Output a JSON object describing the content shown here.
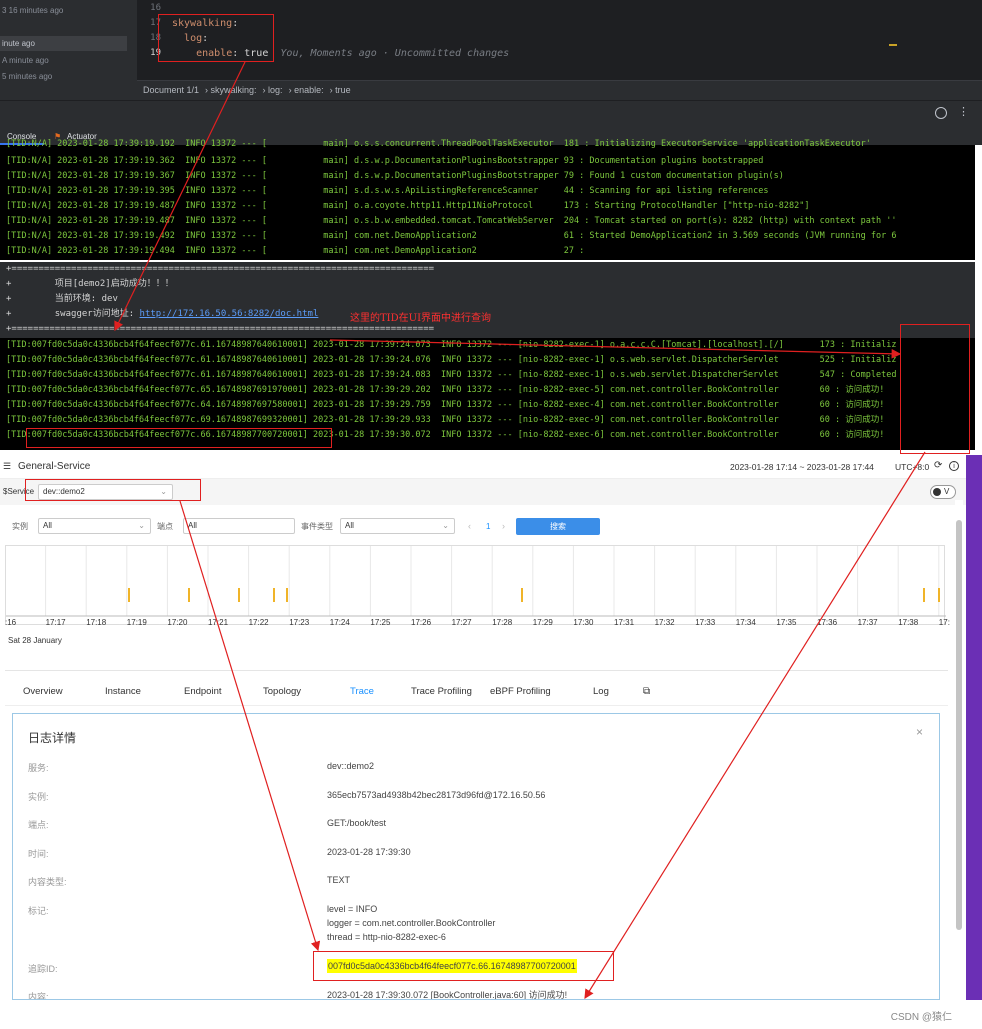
{
  "ide": {
    "sidebar_items": [
      "3 16 minutes ago",
      "inute ago",
      "A minute ago",
      "5 minutes ago"
    ],
    "gutter": [
      "16",
      "17",
      "18",
      "19"
    ],
    "code": {
      "line17_key": "skywalking",
      "line18_key": "log",
      "line19_key": "enable",
      "line19_value": "true",
      "line19_blame": "You, Moments ago · Uncommitted changes"
    },
    "breadcrumb": [
      "Document 1/1",
      "skywalking:",
      "log:",
      "enable:",
      "true"
    ],
    "tabs": {
      "console": "Console",
      "actuator": "Actuator"
    }
  },
  "console_top": [
    "[TID:N/A] 2023-01-28 17:39:19.192  INFO 13372 --- [           main] o.s.s.concurrent.ThreadPoolTaskExecutor  181 : Initializing ExecutorService 'applicationTaskExecutor'",
    "[TID:N/A] 2023-01-28 17:39:19.362  INFO 13372 --- [           main] d.s.w.p.DocumentationPluginsBootstrapper 93 : Documentation plugins bootstrapped",
    "[TID:N/A] 2023-01-28 17:39:19.367  INFO 13372 --- [           main] d.s.w.p.DocumentationPluginsBootstrapper 79 : Found 1 custom documentation plugin(s)",
    "[TID:N/A] 2023-01-28 17:39:19.395  INFO 13372 --- [           main] s.d.s.w.s.ApiListingReferenceScanner     44 : Scanning for api listing references",
    "[TID:N/A] 2023-01-28 17:39:19.487  INFO 13372 --- [           main] o.a.coyote.http11.Http11NioProtocol      173 : Starting ProtocolHandler [\"http-nio-8282\"]",
    "[TID:N/A] 2023-01-28 17:39:19.487  INFO 13372 --- [           main] o.s.b.w.embedded.tomcat.TomcatWebServer  204 : Tomcat started on port(s): 8282 (http) with context path ''",
    "[TID:N/A] 2023-01-28 17:39:19.492  INFO 13372 --- [           main] com.net.DemoApplication2                 61 : Started DemoApplication2 in 3.569 seconds (JVM running for 6",
    "[TID:N/A] 2023-01-28 17:39:19.494  INFO 13372 --- [           main] com.net.DemoApplication2                 27 :"
  ],
  "banner": {
    "rule": "+==============================================================================",
    "line1": "+        项目[demo2]启动成功！！！",
    "line2": "+        当前环境: dev",
    "line3_prefix": "+        swagger访问地址: ",
    "line3_link": "http://172.16.50.56:8282/doc.html",
    "annotation": "这里的TID在UI界面中进行查询"
  },
  "console_bottom": [
    "[TID:007fd0c5da0c4336bcb4f64feecf077c.61.16748987640610001] 2023-01-28 17:39:24.073  INFO 13372 --- [nio-8282-exec-1] o.a.c.c.C.[Tomcat].[localhost].[/]       173 : Initializ",
    "[TID:007fd0c5da0c4336bcb4f64feecf077c.61.16748987640610001] 2023-01-28 17:39:24.076  INFO 13372 --- [nio-8282-exec-1] o.s.web.servlet.DispatcherServlet        525 : Initializ",
    "[TID:007fd0c5da0c4336bcb4f64feecf077c.61.16748987640610001] 2023-01-28 17:39:24.083  INFO 13372 --- [nio-8282-exec-1] o.s.web.servlet.DispatcherServlet        547 : Completed",
    "[TID:007fd0c5da0c4336bcb4f64feecf077c.65.16748987691970001] 2023-01-28 17:39:29.202  INFO 13372 --- [nio-8282-exec-5] com.net.controller.BookController        60 : 访问成功!",
    "[TID:007fd0c5da0c4336bcb4f64feecf077c.64.16748987697580001] 2023-01-28 17:39:29.759  INFO 13372 --- [nio-8282-exec-4] com.net.controller.BookController        60 : 访问成功!",
    "[TID:007fd0c5da0c4336bcb4f64feecf077c.69.16748987699320001] 2023-01-28 17:39:29.933  INFO 13372 --- [nio-8282-exec-9] com.net.controller.BookController        60 : 访问成功!",
    "[TID:007fd0c5da0c4336bcb4f64feecf077c.66.16748987700720001] 2023-01-28 17:39:30.072  INFO 13372 --- [nio-8282-exec-6] com.net.controller.BookController        60 : 访问成功!"
  ],
  "sw": {
    "title": "General-Service",
    "time_range": "2023-01-28 17:14 ~ 2023-01-28 17:44",
    "timezone": "UTC+8:0",
    "service_label": "$Service",
    "service_value": "dev::demo2",
    "toggle_label": "V",
    "filters": {
      "instance_label": "实例",
      "instance_value": "All",
      "endpoint_label": "端点",
      "endpoint_value": "All",
      "event_label": "事件类型",
      "event_value": "All",
      "page": "1",
      "search_button": "搜索"
    },
    "timeline": {
      "ticks": ":16|17:17|17:18|17:19|17:20|17:21|17:22|17:23|17:24|17:25|17:26|17:27|17:28|17:29|17:30|17:31|17:32|17:33|17:34|17:35|17:36|17:37|17:38|17:",
      "date": "Sat 28 January"
    },
    "nav": [
      "Overview",
      "Instance",
      "Endpoint",
      "Topology",
      "Trace",
      "Trace Profiling",
      "eBPF Profiling",
      "Log"
    ],
    "detail": {
      "title": "日志详情",
      "fields": [
        {
          "k": "服务:",
          "v": "dev::demo2"
        },
        {
          "k": "实例:",
          "v": "365ecb7573ad4938b42bec28173d96fd@172.16.50.56"
        },
        {
          "k": "端点:",
          "v": "GET:/book/test"
        },
        {
          "k": "时间:",
          "v": "2023-01-28 17:39:30"
        },
        {
          "k": "内容类型:",
          "v": "TEXT"
        }
      ],
      "tags_label": "标记:",
      "tags": [
        "level = INFO",
        "logger = com.net.controller.BookController",
        "thread = http-nio-8282-exec-6"
      ],
      "trace_label": "追踪ID:",
      "trace_value": "007fd0c5da0c4336bcb4f64feecf077c.66.16748987700720001",
      "content_label": "内容:",
      "content_value": "2023-01-28 17:39:30.072 [BookController.java:60] 访问成功!"
    }
  },
  "watermark": "CSDN @猿仁",
  "colors": {
    "accent": "#1890ff",
    "highlight": "#ffff00",
    "annotation_red": "#e02020",
    "console_green": "#7dc83e"
  }
}
